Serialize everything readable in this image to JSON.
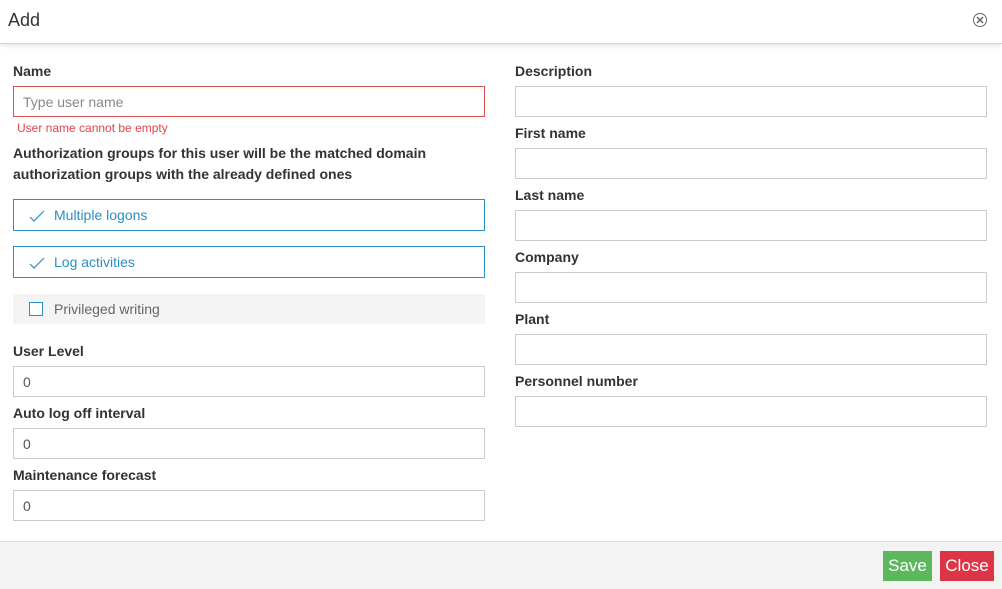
{
  "dialog": {
    "title": "Add",
    "close_icon": "close-circle-icon"
  },
  "left": {
    "name": {
      "label": "Name",
      "placeholder": "Type user name",
      "value": "",
      "error": "User name cannot be empty"
    },
    "info_text": "Authorization groups for this user will be the matched domain authorization groups with the already defined ones",
    "toggles": [
      {
        "label": "Multiple logons",
        "checked": true,
        "icon": "check-icon"
      },
      {
        "label": "Log activities",
        "checked": true,
        "icon": "check-icon"
      }
    ],
    "privileged_writing": {
      "label": "Privileged writing",
      "checked": false
    },
    "user_level": {
      "label": "User Level",
      "value": "0"
    },
    "auto_log_off": {
      "label": "Auto log off interval",
      "value": "0"
    },
    "maintenance_forecast": {
      "label": "Maintenance forecast",
      "value": "0"
    }
  },
  "right": {
    "description": {
      "label": "Description",
      "value": ""
    },
    "first_name": {
      "label": "First name",
      "value": ""
    },
    "last_name": {
      "label": "Last name",
      "value": ""
    },
    "company": {
      "label": "Company",
      "value": ""
    },
    "plant": {
      "label": "Plant",
      "value": ""
    },
    "personnel_number": {
      "label": "Personnel number",
      "value": ""
    }
  },
  "footer": {
    "save_label": "Save",
    "close_label": "Close"
  },
  "colors": {
    "accent": "#2a8fc2",
    "error": "#d9534f",
    "save": "#5cb85c",
    "close": "#dc3545"
  }
}
